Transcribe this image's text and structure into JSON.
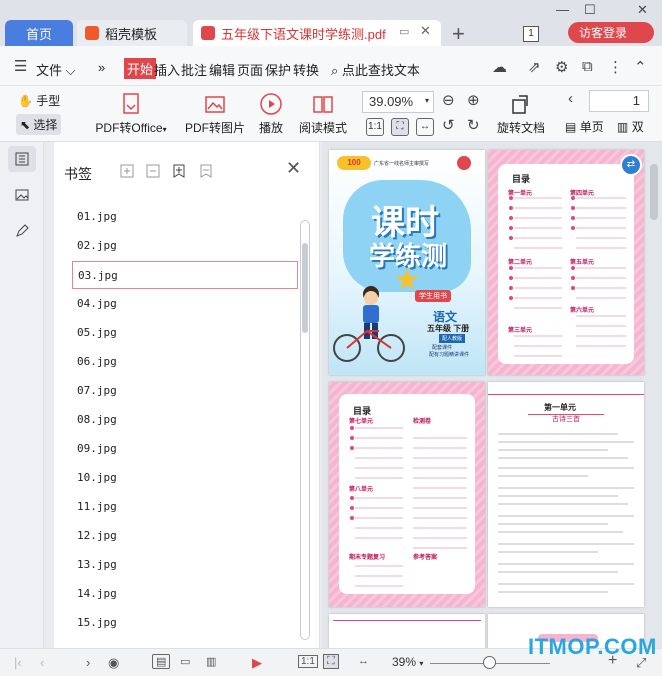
{
  "titlebar": {
    "tabs": [
      {
        "label": "首页"
      },
      {
        "label": "稻壳模板"
      },
      {
        "label": "五年级下语文课时学练测.pdf"
      }
    ],
    "window_count": "1",
    "visitor_label": "访客登录"
  },
  "menu": {
    "file": "文件",
    "items": [
      "开始",
      "插入",
      "批注",
      "编辑",
      "页面",
      "保护",
      "转换"
    ],
    "search": "点此查找文本"
  },
  "toolbar": {
    "hand": "手型",
    "select": "选择",
    "pdf_to_office": "PDF转Office",
    "pdf_to_image": "PDF转图片",
    "play": "播放",
    "read_mode": "阅读模式",
    "zoom": "39.09%",
    "rotate": "旋转文档",
    "single_page": "单页",
    "double_page": "双",
    "page_number": "1"
  },
  "panel": {
    "title": "书签",
    "bookmarks": [
      "01.jpg",
      "02.jpg",
      "03.jpg",
      "04.jpg",
      "05.jpg",
      "06.jpg",
      "07.jpg",
      "08.jpg",
      "09.jpg",
      "10.jpg",
      "11.jpg",
      "12.jpg",
      "13.jpg",
      "14.jpg",
      "15.jpg"
    ],
    "selected_index": 2
  },
  "document": {
    "cover": {
      "top_text": "广东省一线名师主审撰写",
      "title1": "课时",
      "title2": "学练测",
      "badge": "学生用书",
      "subject": "语文",
      "grade": "五年级 下册",
      "edition": "配人教版",
      "note1": "配套课件",
      "note2": "配有习题精讲课件"
    },
    "toc_title": "目录",
    "toc_page1": {
      "units_left": [
        "第一单元",
        "第二单元",
        "第三单元"
      ],
      "units_right": [
        "第四单元",
        "第五单元",
        "第六单元"
      ]
    },
    "toc_page2": {
      "units_left": [
        "第七单元",
        "第八单元",
        "期末专题复习"
      ],
      "units_right": [
        "检测卷",
        "参考答案"
      ]
    },
    "lesson_page": {
      "unit": "第一单元",
      "lesson": "古诗三首"
    }
  },
  "statusbar": {
    "zoom": "39%"
  },
  "watermark": "ITMOP.COM"
}
